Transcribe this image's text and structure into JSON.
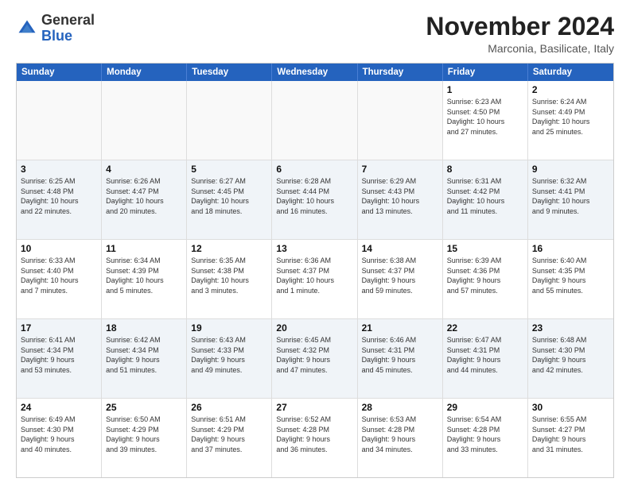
{
  "header": {
    "logo_general": "General",
    "logo_blue": "Blue",
    "month_title": "November 2024",
    "location": "Marconia, Basilicate, Italy"
  },
  "days_of_week": [
    "Sunday",
    "Monday",
    "Tuesday",
    "Wednesday",
    "Thursday",
    "Friday",
    "Saturday"
  ],
  "weeks": [
    [
      {
        "day": "",
        "info": ""
      },
      {
        "day": "",
        "info": ""
      },
      {
        "day": "",
        "info": ""
      },
      {
        "day": "",
        "info": ""
      },
      {
        "day": "",
        "info": ""
      },
      {
        "day": "1",
        "info": "Sunrise: 6:23 AM\nSunset: 4:50 PM\nDaylight: 10 hours\nand 27 minutes."
      },
      {
        "day": "2",
        "info": "Sunrise: 6:24 AM\nSunset: 4:49 PM\nDaylight: 10 hours\nand 25 minutes."
      }
    ],
    [
      {
        "day": "3",
        "info": "Sunrise: 6:25 AM\nSunset: 4:48 PM\nDaylight: 10 hours\nand 22 minutes."
      },
      {
        "day": "4",
        "info": "Sunrise: 6:26 AM\nSunset: 4:47 PM\nDaylight: 10 hours\nand 20 minutes."
      },
      {
        "day": "5",
        "info": "Sunrise: 6:27 AM\nSunset: 4:45 PM\nDaylight: 10 hours\nand 18 minutes."
      },
      {
        "day": "6",
        "info": "Sunrise: 6:28 AM\nSunset: 4:44 PM\nDaylight: 10 hours\nand 16 minutes."
      },
      {
        "day": "7",
        "info": "Sunrise: 6:29 AM\nSunset: 4:43 PM\nDaylight: 10 hours\nand 13 minutes."
      },
      {
        "day": "8",
        "info": "Sunrise: 6:31 AM\nSunset: 4:42 PM\nDaylight: 10 hours\nand 11 minutes."
      },
      {
        "day": "9",
        "info": "Sunrise: 6:32 AM\nSunset: 4:41 PM\nDaylight: 10 hours\nand 9 minutes."
      }
    ],
    [
      {
        "day": "10",
        "info": "Sunrise: 6:33 AM\nSunset: 4:40 PM\nDaylight: 10 hours\nand 7 minutes."
      },
      {
        "day": "11",
        "info": "Sunrise: 6:34 AM\nSunset: 4:39 PM\nDaylight: 10 hours\nand 5 minutes."
      },
      {
        "day": "12",
        "info": "Sunrise: 6:35 AM\nSunset: 4:38 PM\nDaylight: 10 hours\nand 3 minutes."
      },
      {
        "day": "13",
        "info": "Sunrise: 6:36 AM\nSunset: 4:37 PM\nDaylight: 10 hours\nand 1 minute."
      },
      {
        "day": "14",
        "info": "Sunrise: 6:38 AM\nSunset: 4:37 PM\nDaylight: 9 hours\nand 59 minutes."
      },
      {
        "day": "15",
        "info": "Sunrise: 6:39 AM\nSunset: 4:36 PM\nDaylight: 9 hours\nand 57 minutes."
      },
      {
        "day": "16",
        "info": "Sunrise: 6:40 AM\nSunset: 4:35 PM\nDaylight: 9 hours\nand 55 minutes."
      }
    ],
    [
      {
        "day": "17",
        "info": "Sunrise: 6:41 AM\nSunset: 4:34 PM\nDaylight: 9 hours\nand 53 minutes."
      },
      {
        "day": "18",
        "info": "Sunrise: 6:42 AM\nSunset: 4:34 PM\nDaylight: 9 hours\nand 51 minutes."
      },
      {
        "day": "19",
        "info": "Sunrise: 6:43 AM\nSunset: 4:33 PM\nDaylight: 9 hours\nand 49 minutes."
      },
      {
        "day": "20",
        "info": "Sunrise: 6:45 AM\nSunset: 4:32 PM\nDaylight: 9 hours\nand 47 minutes."
      },
      {
        "day": "21",
        "info": "Sunrise: 6:46 AM\nSunset: 4:31 PM\nDaylight: 9 hours\nand 45 minutes."
      },
      {
        "day": "22",
        "info": "Sunrise: 6:47 AM\nSunset: 4:31 PM\nDaylight: 9 hours\nand 44 minutes."
      },
      {
        "day": "23",
        "info": "Sunrise: 6:48 AM\nSunset: 4:30 PM\nDaylight: 9 hours\nand 42 minutes."
      }
    ],
    [
      {
        "day": "24",
        "info": "Sunrise: 6:49 AM\nSunset: 4:30 PM\nDaylight: 9 hours\nand 40 minutes."
      },
      {
        "day": "25",
        "info": "Sunrise: 6:50 AM\nSunset: 4:29 PM\nDaylight: 9 hours\nand 39 minutes."
      },
      {
        "day": "26",
        "info": "Sunrise: 6:51 AM\nSunset: 4:29 PM\nDaylight: 9 hours\nand 37 minutes."
      },
      {
        "day": "27",
        "info": "Sunrise: 6:52 AM\nSunset: 4:28 PM\nDaylight: 9 hours\nand 36 minutes."
      },
      {
        "day": "28",
        "info": "Sunrise: 6:53 AM\nSunset: 4:28 PM\nDaylight: 9 hours\nand 34 minutes."
      },
      {
        "day": "29",
        "info": "Sunrise: 6:54 AM\nSunset: 4:28 PM\nDaylight: 9 hours\nand 33 minutes."
      },
      {
        "day": "30",
        "info": "Sunrise: 6:55 AM\nSunset: 4:27 PM\nDaylight: 9 hours\nand 31 minutes."
      }
    ]
  ]
}
